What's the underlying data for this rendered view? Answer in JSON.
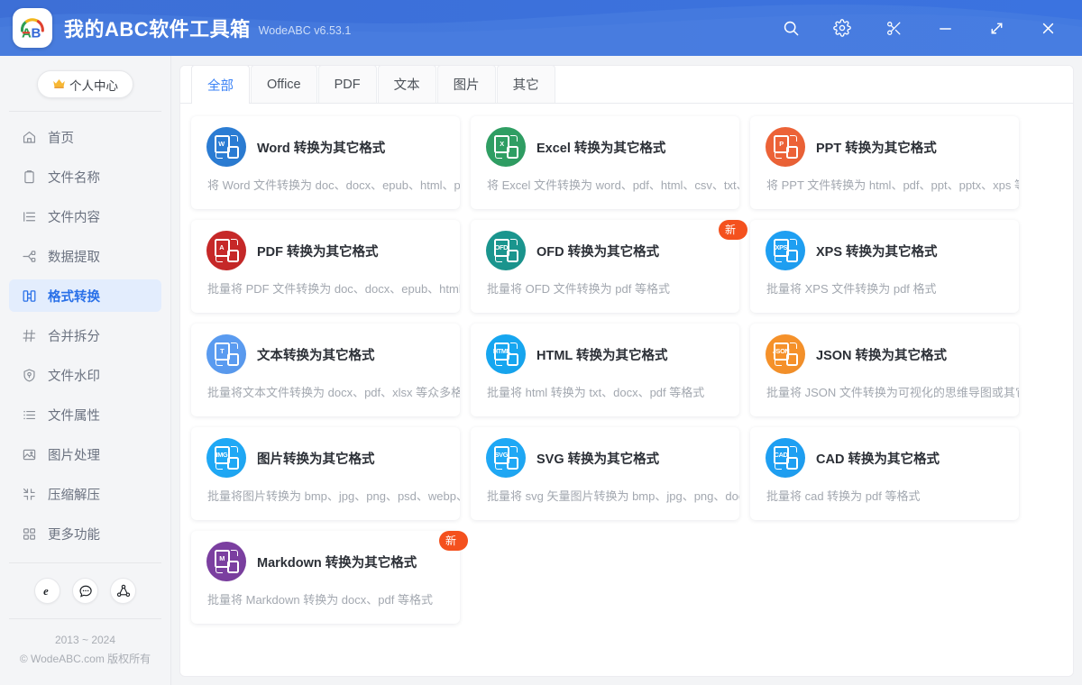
{
  "header": {
    "title": "我的ABC软件工具箱",
    "version": "WodeABC v6.53.1",
    "logo_letters": "AB",
    "buttons": [
      {
        "name": "search-icon",
        "label": "搜索"
      },
      {
        "name": "settings-gear-icon",
        "label": "设置"
      },
      {
        "name": "scissors-icon",
        "label": "截图"
      },
      {
        "name": "minimize-icon",
        "label": "最小化"
      },
      {
        "name": "maximize-icon",
        "label": "最大化"
      },
      {
        "name": "close-icon",
        "label": "关闭"
      }
    ],
    "bg_color": "#3a6fd8"
  },
  "sidebar": {
    "vip_label": "个人中心",
    "vip_crown": "👑",
    "items": [
      {
        "label": "首页",
        "icon": "home-icon",
        "active": false
      },
      {
        "label": "文件名称",
        "icon": "clipboard-icon",
        "active": false
      },
      {
        "label": "文件内容",
        "icon": "list-indent-icon",
        "active": false
      },
      {
        "label": "数据提取",
        "icon": "extract-icon",
        "active": false
      },
      {
        "label": "格式转换",
        "icon": "convert-icon",
        "active": true
      },
      {
        "label": "合并拆分",
        "icon": "grid-hash-icon",
        "active": false
      },
      {
        "label": "文件水印",
        "icon": "shield-icon",
        "active": false
      },
      {
        "label": "文件属性",
        "icon": "list-icon",
        "active": false
      },
      {
        "label": "图片处理",
        "icon": "image-icon",
        "active": false
      },
      {
        "label": "压缩解压",
        "icon": "compress-icon",
        "active": false
      },
      {
        "label": "更多功能",
        "icon": "apps-grid-icon",
        "active": false
      }
    ],
    "social": [
      {
        "name": "browser-ie-icon",
        "glyph": "e"
      },
      {
        "name": "chat-bubble-icon",
        "glyph": "···"
      },
      {
        "name": "share-network-icon",
        "glyph": "share"
      }
    ],
    "copyright_years": "2013 ~ 2024",
    "copyright_text": "© WodeABC.com 版权所有",
    "active_color": "#2970e8"
  },
  "main": {
    "tabs": [
      {
        "label": "全部",
        "active": true
      },
      {
        "label": "Office",
        "active": false
      },
      {
        "label": "PDF",
        "active": false
      },
      {
        "label": "文本",
        "active": false
      },
      {
        "label": "图片",
        "active": false
      },
      {
        "label": "其它",
        "active": false
      }
    ],
    "cards": [
      {
        "title": "Word 转换为其它格式",
        "desc": "将 Word 文件转换为 doc、docx、epub、html、pd",
        "icon_text": "W",
        "icon_color": "#2b7cd3",
        "badge": null
      },
      {
        "title": "Excel 转换为其它格式",
        "desc": "将 Excel 文件转换为 word、pdf、html、csv、txt、s",
        "icon_text": "X",
        "icon_color": "#2f9e63",
        "badge": null
      },
      {
        "title": "PPT 转换为其它格式",
        "desc": "将 PPT 文件转换为 html、pdf、ppt、pptx、xps 等x",
        "icon_text": "P",
        "icon_color": "#ec6237",
        "badge": null
      },
      {
        "title": "PDF 转换为其它格式",
        "desc": "批量将 PDF 文件转换为 doc、docx、epub、html、",
        "icon_text": "A",
        "icon_color": "#c62828",
        "badge": null
      },
      {
        "title": "OFD 转换为其它格式",
        "desc": "批量将 OFD 文件转换为 pdf 等格式",
        "icon_text": "OFD",
        "icon_color": "#1a958e",
        "badge": "新"
      },
      {
        "title": "XPS 转换为其它格式",
        "desc": "批量将 XPS 文件转换为 pdf 格式",
        "icon_text": "XPS",
        "icon_color": "#1e9ff2",
        "badge": null
      },
      {
        "title": "文本转换为其它格式",
        "desc": "批量将文本文件转换为 docx、pdf、xlsx 等众多格式",
        "icon_text": "T",
        "icon_color": "#5a9bf0",
        "badge": null
      },
      {
        "title": "HTML 转换为其它格式",
        "desc": "批量将 html 转换为 txt、docx、pdf 等格式",
        "icon_text": "HTML",
        "icon_color": "#16a6f0",
        "badge": null
      },
      {
        "title": "JSON 转换为其它格式",
        "desc": "批量将 JSON 文件转换为可视化的思维导图或其它格",
        "icon_text": "JSON",
        "icon_color": "#f5912a",
        "badge": null
      },
      {
        "title": "图片转换为其它格式",
        "desc": "批量将图片转换为 bmp、jpg、png、psd、webp、",
        "icon_text": "IMG",
        "icon_color": "#1fa8f5",
        "badge": null
      },
      {
        "title": "SVG 转换为其它格式",
        "desc": "批量将 svg 矢量图片转换为 bmp、jpg、png、docx",
        "icon_text": "SVG",
        "icon_color": "#1fa8f5",
        "badge": null
      },
      {
        "title": "CAD 转换为其它格式",
        "desc": "批量将 cad 转换为 pdf 等格式",
        "icon_text": "CAD",
        "icon_color": "#1e9ff2",
        "badge": null
      },
      {
        "title": "Markdown 转换为其它格式",
        "desc": "批量将 Markdown 转换为 docx、pdf 等格式",
        "icon_text": "M",
        "icon_color": "#7b3fa0",
        "badge": "新"
      }
    ]
  }
}
